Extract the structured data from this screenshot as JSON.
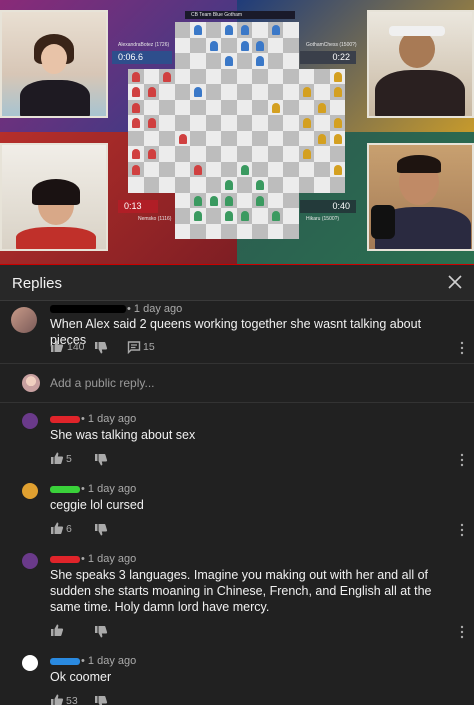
{
  "video": {
    "title_strip": "CB Team Blue Gotham",
    "players": {
      "top_left": {
        "name": "AlexandraBotez (1726)",
        "clock": "0:06.6"
      },
      "top_right": {
        "name": "GothamChess (1500?)",
        "clock": "0:22"
      },
      "bottom_left": {
        "name": "Nemsko (1116)",
        "clock": "0:13"
      },
      "bottom_right": {
        "name": "Hikaru (1500?)",
        "clock": "0:40"
      }
    }
  },
  "replies_header": {
    "title": "Replies",
    "close_icon": "close-icon"
  },
  "main_comment": {
    "time": "• 1 day ago",
    "text": "When Alex said 2 queens working together she wasnt talking about pieces",
    "likes": "140",
    "replies": "15"
  },
  "reply_input": {
    "placeholder": "Add a public reply..."
  },
  "replies": [
    {
      "time": "• 1 day ago",
      "text": "She was talking about sex",
      "likes": "5",
      "redact_color": "#e0242a",
      "avatar": "#6a3a8a"
    },
    {
      "time": "• 1 day ago",
      "text": "ceggie lol cursed",
      "likes": "6",
      "redact_color": "#3ad13a",
      "avatar": "#e0a030"
    },
    {
      "time": "• 1 day ago",
      "text": "She speaks 3 languages. Imagine you making out with her and all of sudden she starts moaning in Chinese, French, and English all at the same time. Holy damn lord have mercy.",
      "likes": "",
      "redact_color": "#e0242a",
      "avatar": "#6a3a8a"
    },
    {
      "time": "• 1 day ago",
      "text": "Ok coomer",
      "likes": "53",
      "redact_color": "#2a8ae0",
      "avatar": "#ffffff"
    }
  ]
}
